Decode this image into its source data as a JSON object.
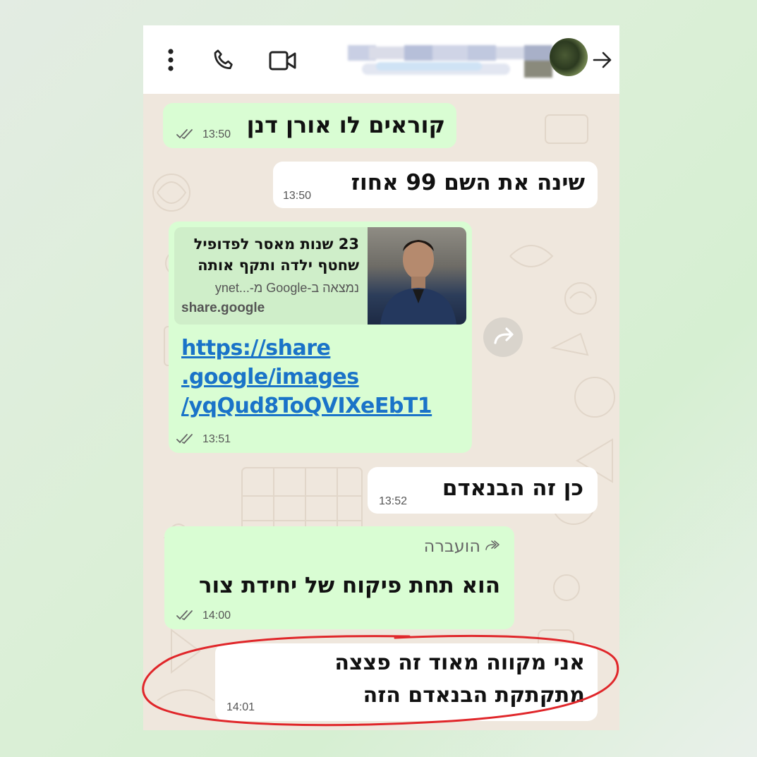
{
  "header": {
    "contact_name_blurred": "",
    "icons": [
      "menu-kebab-icon",
      "phone-call-icon",
      "video-call-icon",
      "forward-arrow-icon"
    ]
  },
  "messages": [
    {
      "id": 1,
      "direction": "outgoing",
      "text": "קוראים לו אורן דנן",
      "time": "13:50",
      "read": true
    },
    {
      "id": 2,
      "direction": "incoming",
      "text": "שינה את השם 99 אחוז",
      "time": "13:50"
    },
    {
      "id": 3,
      "direction": "outgoing",
      "type": "link-preview",
      "preview": {
        "title_line1": "23 שנות מאסר לפדופיל",
        "title_line2": "שחטף ילדה ותקף אותה",
        "source": "נמצאה ב-Google מ-...ynet",
        "domain": "share.google"
      },
      "link_lines": [
        "https://share",
        ".google/images",
        "/yqQud8ToQVIXeEbT1"
      ],
      "time": "13:51",
      "read": true
    },
    {
      "id": 4,
      "direction": "incoming",
      "text": "כן זה הבנאדם",
      "time": "13:52"
    },
    {
      "id": 5,
      "direction": "outgoing",
      "forwarded_label": "הועברה",
      "text": "הוא תחת פיקוח של יחידת צור",
      "time": "14:00",
      "read": true
    },
    {
      "id": 6,
      "direction": "incoming",
      "text_line1": "אני מקווה מאוד זה פצצה",
      "text_line2": "מתקתקת הבנאדם הזה",
      "time": "14:01",
      "highlighted": true
    }
  ],
  "colors": {
    "outgoing_bubble": "#d9fdd3",
    "incoming_bubble": "#ffffff",
    "chat_background": "#efe7dd",
    "link": "#1a73c8",
    "highlight_circle": "#e0262a"
  }
}
